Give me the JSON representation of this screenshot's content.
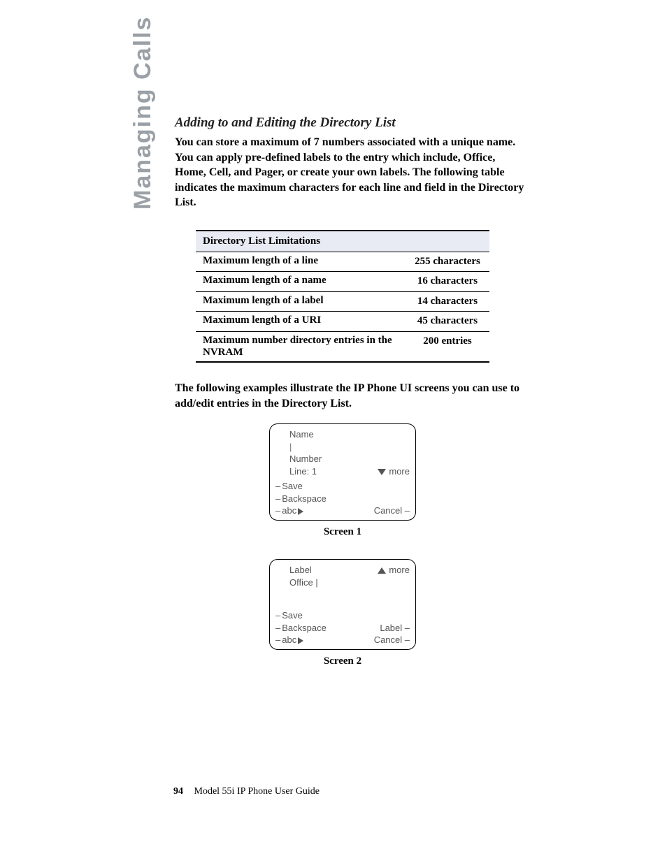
{
  "side_label": "Managing Calls",
  "section_title": "Adding to and Editing the Directory List",
  "intro": "You can store a maximum of 7 numbers associated with a unique name. You can apply pre-defined labels to the entry which include, Office, Home, Cell, and Pager, or create your own labels. The following table indicates the maximum characters for each line and field in the Directory List.",
  "table_header": "Directory List Limitations",
  "table_rows": [
    {
      "label": "Maximum length of a line",
      "value": "255 characters"
    },
    {
      "label": "Maximum length of a name",
      "value": "16 characters"
    },
    {
      "label": "Maximum length of a label",
      "value": "14 characters"
    },
    {
      "label": "Maximum length of a URI",
      "value": "45 characters"
    },
    {
      "label": "Maximum number directory entries in the NVRAM",
      "value": "200 entries"
    }
  ],
  "mid_text": "The following examples illustrate the IP Phone UI screens you can use to add/edit entries in the Directory List.",
  "screen1": {
    "name": "Name",
    "cursor": "|",
    "number": "Number",
    "line": "Line: 1",
    "more": "more",
    "save": "Save",
    "backspace": "Backspace",
    "abc": "abc",
    "cancel": "Cancel",
    "caption": "Screen 1"
  },
  "screen2": {
    "label": "Label",
    "office": "Office |",
    "more": "more",
    "save": "Save",
    "backspace": "Backspace",
    "abc": "abc",
    "label_btn": "Label",
    "cancel": "Cancel",
    "caption": "Screen 2"
  },
  "footer": {
    "page_num": "94",
    "doc_title": "Model 55i IP Phone User Guide"
  }
}
